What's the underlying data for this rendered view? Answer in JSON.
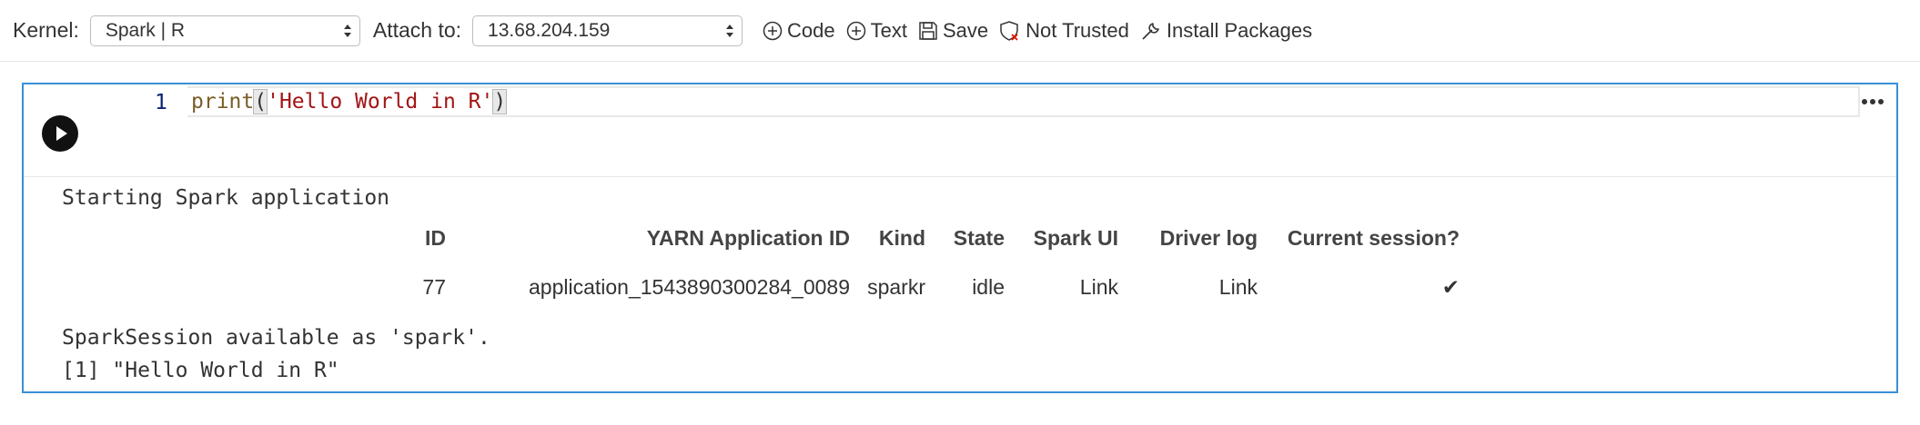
{
  "toolbar": {
    "kernel_label": "Kernel:",
    "kernel_value": "Spark | R",
    "attach_label": "Attach to:",
    "attach_value": "13.68.204.159",
    "code_button": "Code",
    "text_button": "Text",
    "save_button": "Save",
    "trust_button": "Not Trusted",
    "install_button": "Install Packages"
  },
  "cell": {
    "line_number": "1",
    "code_fn": "print",
    "code_open": "(",
    "code_string": "'Hello World in R'",
    "code_close": ")",
    "output": {
      "starting_text": "Starting Spark application",
      "table": {
        "headers": [
          "ID",
          "YARN Application ID",
          "Kind",
          "State",
          "Spark UI",
          "Driver log",
          "Current session?"
        ],
        "row": [
          "77",
          "application_1543890300284_0089",
          "sparkr",
          "idle",
          "Link",
          "Link",
          "✔"
        ]
      },
      "session_text": "SparkSession available as 'spark'.",
      "result_text": "[1] \"Hello World in R\""
    }
  },
  "colors": {
    "cell_border": "#3a8fd6",
    "code_function": "#795e26",
    "code_string": "#a31515",
    "line_number": "#0b216f"
  }
}
